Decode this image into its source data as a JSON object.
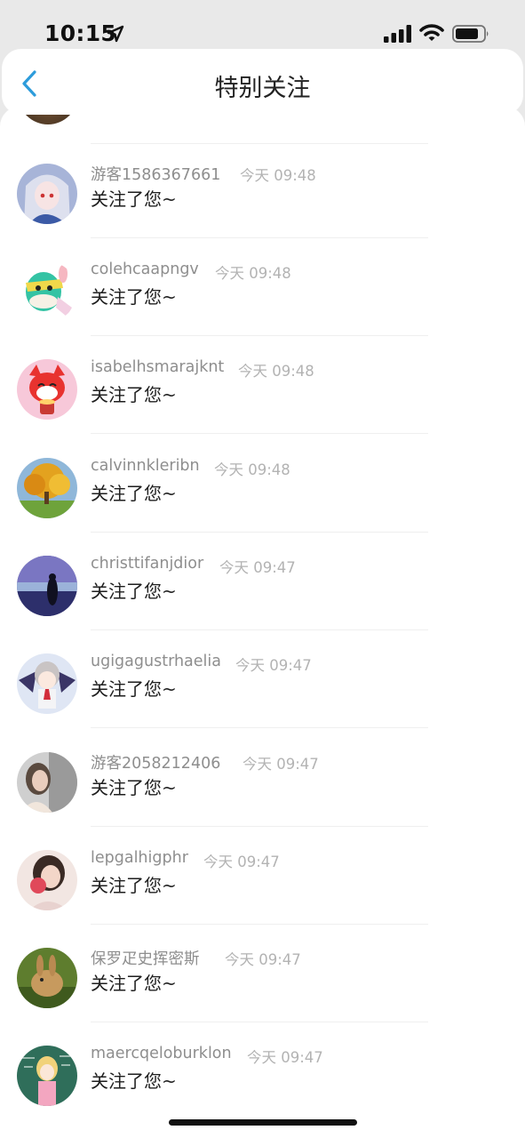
{
  "status_bar": {
    "time": "10:15"
  },
  "header": {
    "title": "特别关注"
  },
  "notifications": [
    {
      "user": "游客1586367661",
      "time": "今天 09:48",
      "message": "关注了您~",
      "avatar": "anime-girl-avatar"
    },
    {
      "user": "colehcaapngv",
      "time": "今天 09:48",
      "message": "关注了您~",
      "avatar": "cartoon-animal-avatar"
    },
    {
      "user": "isabelhsmarajknt",
      "time": "今天 09:48",
      "message": "关注了您~",
      "avatar": "red-fox-cartoon-avatar"
    },
    {
      "user": "calvinnkleribn",
      "time": "今天 09:48",
      "message": "关注了您~",
      "avatar": "autumn-tree-avatar"
    },
    {
      "user": "christtifanjdior",
      "time": "今天 09:47",
      "message": "关注了您~",
      "avatar": "girl-at-lake-avatar"
    },
    {
      "user": "ugigagustrhaelia",
      "time": "今天 09:47",
      "message": "关注了您~",
      "avatar": "anime-boy-wings-avatar"
    },
    {
      "user": "游客2058212406",
      "time": "今天 09:47",
      "message": "关注了您~",
      "avatar": "woman-photo-avatar"
    },
    {
      "user": "lepgalhigphr",
      "time": "今天 09:47",
      "message": "关注了您~",
      "avatar": "girl-with-flower-avatar"
    },
    {
      "user": "保罗疋史挥密斯",
      "time": "今天 09:47",
      "message": "关注了您~",
      "avatar": "rabbit-avatar"
    },
    {
      "user": "maercqeloburklon",
      "time": "今天 09:47",
      "message": "关注了您~",
      "avatar": "chalkboard-girl-avatar"
    }
  ],
  "colors": {
    "accent": "#2d9cdb",
    "username": "#8e8e8e",
    "timestamp": "#b3b3b3",
    "message": "#1e1e1e"
  }
}
